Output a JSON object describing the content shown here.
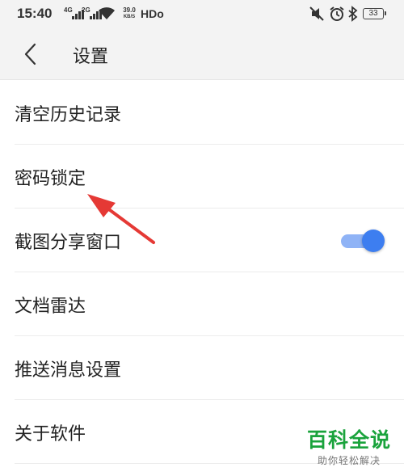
{
  "status_bar": {
    "time": "15:40",
    "sim1_tag": "4G",
    "sim2_tag": "2G",
    "net_speed_value": "39.0",
    "net_speed_unit": "KB/S",
    "hd_label": "HDo",
    "battery": "33",
    "icons": [
      "signal-icon",
      "wifi-icon",
      "mute-icon",
      "alarm-icon",
      "bluetooth-icon",
      "battery-icon"
    ]
  },
  "header": {
    "back_icon": "chevron-left-icon",
    "title": "设置"
  },
  "settings": {
    "items": [
      {
        "label": "清空历史记录"
      },
      {
        "label": "密码锁定"
      },
      {
        "label": "截图分享窗口",
        "toggle_on": true
      },
      {
        "label": "文档雷达"
      },
      {
        "label": "推送消息设置"
      },
      {
        "label": "关于软件"
      }
    ]
  },
  "watermark": {
    "title": "百科全说",
    "subtitle": "助你轻松解决"
  },
  "colors": {
    "toggle_on": "#3d7ef0",
    "toggle_track": "#8fb3f6",
    "annotation_arrow": "#e53935",
    "watermark_green": "#1aa33c"
  }
}
